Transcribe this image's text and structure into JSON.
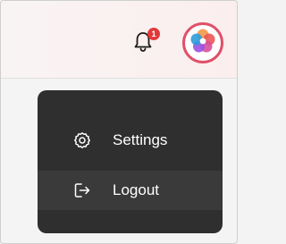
{
  "header": {
    "notifications": {
      "icon": "bell-icon",
      "badge_count": "1",
      "badge_color": "#e23a3a"
    },
    "avatar": {
      "icon": "flower-logo-icon",
      "ring_color": "#e0506a"
    }
  },
  "menu": {
    "background": "#2f2f2f",
    "items": [
      {
        "label": "Settings",
        "icon": "gear-icon"
      },
      {
        "label": "Logout",
        "icon": "logout-icon",
        "highlighted": true
      }
    ]
  }
}
